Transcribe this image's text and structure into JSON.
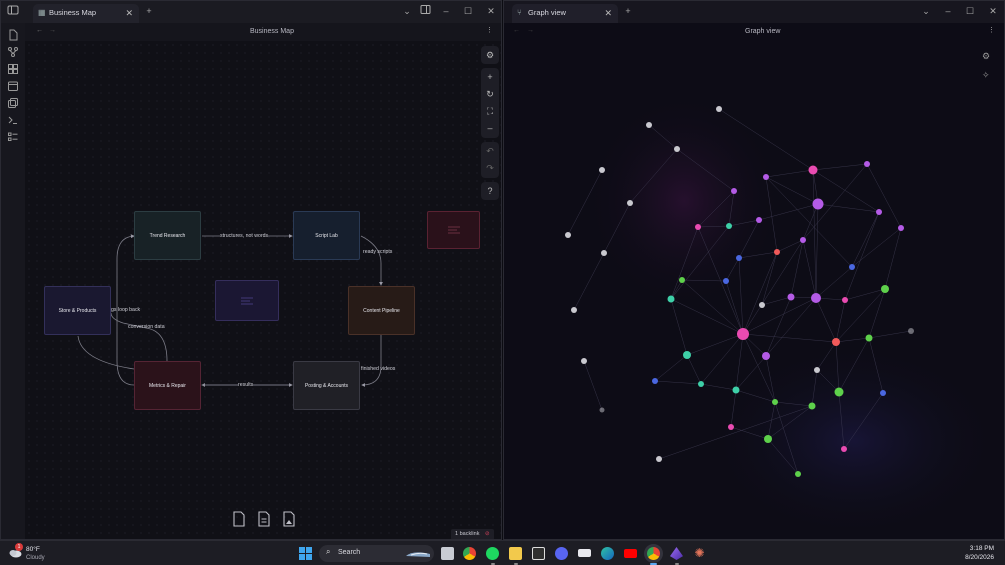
{
  "left_window": {
    "tab_title": "Business Map",
    "view_title": "Business Map",
    "backlink": "1 backlink"
  },
  "right_window": {
    "tab_title": "Graph view",
    "view_title": "Graph view"
  },
  "canvas": {
    "nodes": [
      {
        "id": "trend",
        "label": "Trend Research",
        "color": "#182226",
        "border": "#2c3d42"
      },
      {
        "id": "script",
        "label": "Script Lab",
        "color": "#161f2e",
        "border": "#2a3a55"
      },
      {
        "id": "red-card",
        "label": "",
        "color": "#2a111a",
        "border": "#5a2232"
      },
      {
        "id": "store",
        "label": "Store & Products",
        "color": "#1a1830",
        "border": "#33305a"
      },
      {
        "id": "purple-card",
        "label": "",
        "color": "#1b1733",
        "border": "#352e5c"
      },
      {
        "id": "content",
        "label": "Content Pipeline",
        "color": "#271b17",
        "border": "#4a3128"
      },
      {
        "id": "metrics",
        "label": "Metrics & Repair",
        "color": "#2b121a",
        "border": "#552434"
      },
      {
        "id": "posting",
        "label": "Posting & Accounts",
        "color": "#202026",
        "border": "#3a3a44"
      }
    ],
    "edge_labels": {
      "structures": "structures, not words",
      "ready": "ready scripts",
      "loop": "gs loop back",
      "conversion": "conversion data",
      "results": "results",
      "finished": "finished videos"
    }
  },
  "taskbar": {
    "weather_temp": "80°F",
    "weather_desc": "Cloudy",
    "weather_badge": "1",
    "search_placeholder": "Search",
    "time": "3:18 PM",
    "date": "8/20/2026"
  },
  "accent_colors": {
    "pink": "#e94bb1",
    "violet": "#b45be6",
    "green": "#5ed14b",
    "teal": "#3ed0a8",
    "red": "#f15a5a",
    "blue": "#4a67e0",
    "gray": "#c9c9cf"
  }
}
